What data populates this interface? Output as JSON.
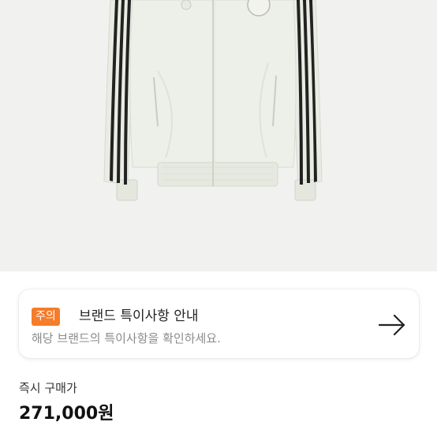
{
  "product": {
    "image_alt": "white track jacket with black three stripes"
  },
  "notice": {
    "badge": "주의",
    "title": "브랜드 특이사항 안내",
    "description": "해당 브랜드의 특이사항을 확인하세요.",
    "icon": "arrow-right-icon"
  },
  "price": {
    "label": "즉시 구매가",
    "value": "271,000원"
  },
  "colors": {
    "badge": "#f57c2a",
    "image_bg": "#f1f1f0"
  }
}
